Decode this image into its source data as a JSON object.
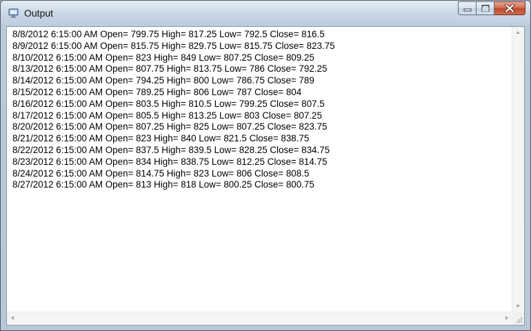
{
  "window": {
    "title": "Output",
    "icon": "monitor-icon",
    "minimize_icon": "minimize-icon",
    "maximize_icon": "maximize-icon",
    "close_icon": "close-icon"
  },
  "output": {
    "lines": [
      "8/8/2012 6:15:00 AM Open= 799.75 High= 817.25 Low= 792.5 Close= 816.5",
      "8/9/2012 6:15:00 AM Open= 815.75 High= 829.75 Low= 815.75 Close= 823.75",
      "8/10/2012 6:15:00 AM Open= 823 High= 849 Low= 807.25 Close= 809.25",
      "8/13/2012 6:15:00 AM Open= 807.75 High= 813.75 Low= 786 Close= 792.25",
      "8/14/2012 6:15:00 AM Open= 794.25 High= 800 Low= 786.75 Close= 789",
      "8/15/2012 6:15:00 AM Open= 789.25 High= 806 Low= 787 Close= 804",
      "8/16/2012 6:15:00 AM Open= 803.5 High= 810.5 Low= 799.25 Close= 807.5",
      "8/17/2012 6:15:00 AM Open= 805.5 High= 813.25 Low= 803 Close= 807.25",
      "8/20/2012 6:15:00 AM Open= 807.25 High= 825 Low= 807.25 Close= 823.75",
      "8/21/2012 6:15:00 AM Open= 823 High= 840 Low= 821.5 Close= 838.75",
      "8/22/2012 6:15:00 AM Open= 837.5 High= 839.5 Low= 828.25 Close= 834.75",
      "8/23/2012 6:15:00 AM Open= 834 High= 838.75 Low= 812.25 Close= 814.75",
      "8/24/2012 6:15:00 AM Open= 814.75 High= 823 Low= 806 Close= 808.5",
      "8/27/2012 6:15:00 AM Open= 813 High= 818 Low= 800.25 Close= 800.75"
    ]
  },
  "colors": {
    "close_button": "#c14a2f",
    "frame": "#b9cad9",
    "text": "#000000"
  }
}
